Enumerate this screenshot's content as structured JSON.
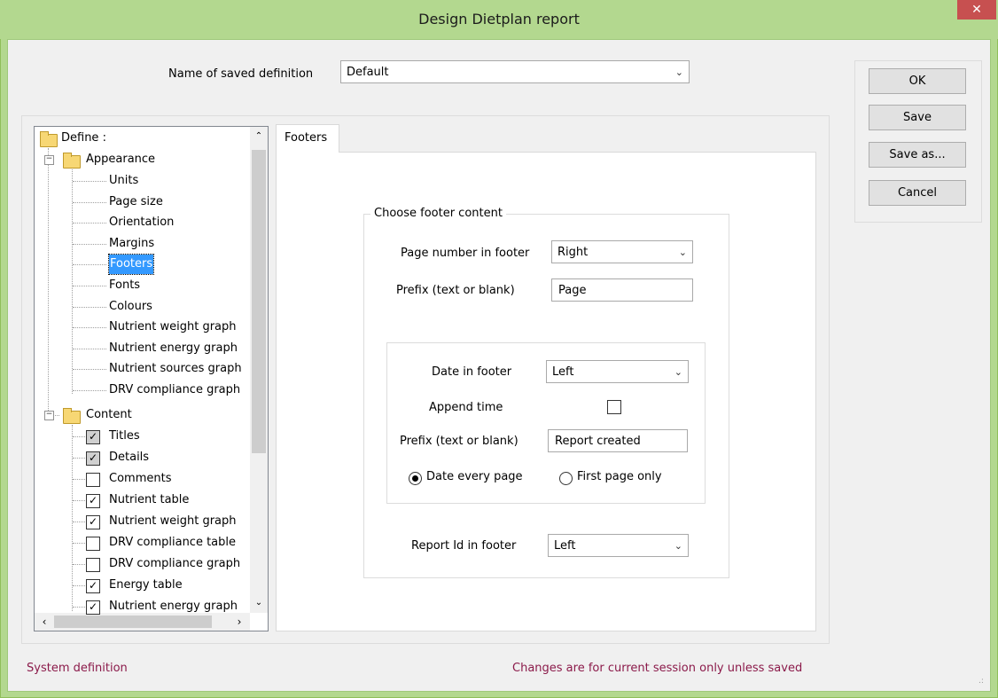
{
  "window": {
    "title": "Design Dietplan report",
    "close_glyph": "✕"
  },
  "definition": {
    "label": "Name of saved definition",
    "value": "Default"
  },
  "buttons": {
    "ok": "OK",
    "save": "Save",
    "save_as": "Save as...",
    "cancel": "Cancel"
  },
  "tree": {
    "root": "Define :",
    "appearance": {
      "label": "Appearance",
      "items": [
        "Units",
        "Page size",
        "Orientation",
        "Margins",
        "Footers",
        "Fonts",
        "Colours",
        "Nutrient weight graph",
        "Nutrient energy graph",
        "Nutrient sources graph",
        "DRV compliance graph"
      ],
      "selected": "Footers"
    },
    "content": {
      "label": "Content",
      "items": [
        {
          "label": "Titles",
          "checked": true,
          "grayed": true
        },
        {
          "label": "Details",
          "checked": true,
          "grayed": true
        },
        {
          "label": "Comments",
          "checked": false
        },
        {
          "label": "Nutrient table",
          "checked": true
        },
        {
          "label": "Nutrient weight graph",
          "checked": true
        },
        {
          "label": "DRV compliance table",
          "checked": false
        },
        {
          "label": "DRV compliance graph",
          "checked": false
        },
        {
          "label": "Energy table",
          "checked": true
        },
        {
          "label": "Nutrient energy graph",
          "checked": true
        }
      ]
    }
  },
  "tab": {
    "label": "Footers"
  },
  "footer": {
    "group_title": "Choose footer content",
    "page_number_label": "Page number in footer",
    "page_number_value": "Right",
    "prefix_label": "Prefix (text or blank)",
    "prefix_value": "Page",
    "date_label": "Date in footer",
    "date_value": "Left",
    "append_time_label": "Append time",
    "date_prefix_label": "Prefix (text or blank)",
    "date_prefix_value": "Report created",
    "radio_every": "Date every page",
    "radio_first": "First page only",
    "report_id_label": "Report Id in footer",
    "report_id_value": "Left"
  },
  "status": {
    "left": "System definition",
    "right": "Changes are for current session only unless saved"
  }
}
